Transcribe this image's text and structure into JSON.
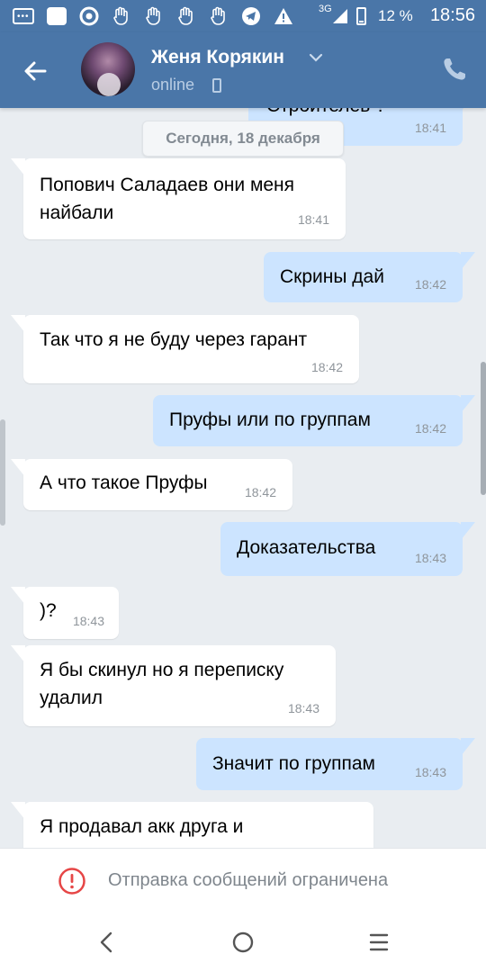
{
  "status_bar": {
    "network_label": "3G",
    "battery_percent": "12 %",
    "time": "18:56",
    "icons": [
      "message-icon",
      "app-icon",
      "chrome-icon",
      "hand-icon",
      "hand-icon",
      "hand-icon",
      "hand-icon",
      "telegram-icon",
      "warning-icon",
      "signal-icon",
      "battery-icon"
    ]
  },
  "header": {
    "contact_name": "Женя Корякин",
    "status": "online",
    "accent_color": "#4a76a8"
  },
  "chat": {
    "partial_top_message": {
      "text": "Строителев ?",
      "time": "18:41"
    },
    "date_separator": "Сегодня, 18 декабря",
    "messages": [
      {
        "side": "in",
        "text": "Попович Саладаев они меня найбали",
        "time": "18:41"
      },
      {
        "side": "out",
        "text": "Скрины дай",
        "time": "18:42"
      },
      {
        "side": "in",
        "text": "Так что я не буду через гарант",
        "time": "18:42"
      },
      {
        "side": "out",
        "text": "Пруфы или по группам",
        "time": "18:42"
      },
      {
        "side": "in",
        "text": "А что такое Пруфы",
        "time": "18:42"
      },
      {
        "side": "out",
        "text": "Доказательства",
        "time": "18:43"
      },
      {
        "side": "in",
        "text": ")?",
        "time": "18:43"
      },
      {
        "side": "in",
        "text": "Я бы скинул но я переписку удалил",
        "time": "18:43"
      },
      {
        "side": "out",
        "text": "Значит по группам",
        "time": "18:43"
      },
      {
        "side": "in",
        "text": "Я продавал акк друга и",
        "time": ""
      }
    ],
    "incoming_color": "#ffffff",
    "outgoing_color": "#cce4ff"
  },
  "restriction": {
    "text": "Отправка сообщений ограничена",
    "icon": "warning-circle-icon",
    "icon_color": "#e64646"
  },
  "navbar": {
    "buttons": [
      "back-icon",
      "home-icon",
      "menu-icon"
    ]
  }
}
